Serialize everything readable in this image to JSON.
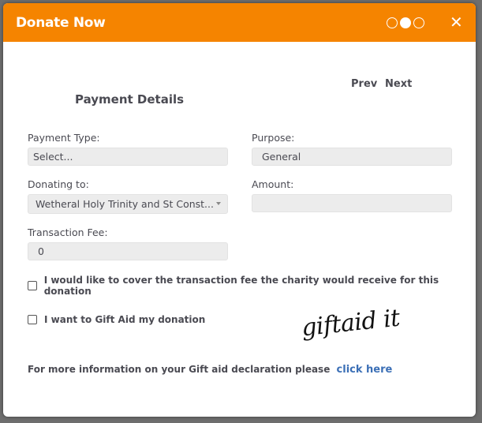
{
  "header": {
    "title": "Donate Now",
    "steps": [
      {
        "state": "inactive"
      },
      {
        "state": "active"
      },
      {
        "state": "inactive"
      }
    ],
    "close_icon": "close-icon",
    "close_glyph": "✕"
  },
  "navigation": {
    "prev_label": "Prev",
    "next_label": "Next"
  },
  "section_title": "Payment Details",
  "form": {
    "payment_type": {
      "label": "Payment Type:",
      "value": "Select..."
    },
    "purpose": {
      "label": "Purpose:",
      "value": "General"
    },
    "donating_to": {
      "label": "Donating to:",
      "value": "Wetheral Holy Trinity and St Const..."
    },
    "amount": {
      "label": "Amount:",
      "value": ""
    },
    "transaction_fee": {
      "label": "Transaction Fee:",
      "value": "0"
    }
  },
  "checkboxes": {
    "cover_fee": {
      "label": "I would like to cover the transaction fee the charity would receive for this donation",
      "checked": false
    },
    "gift_aid": {
      "label": "I want to Gift Aid my donation",
      "checked": false
    }
  },
  "giftaid_logo_text": "giftaid it",
  "info": {
    "text": "For more information on your Gift aid declaration please",
    "link_label": "click here"
  },
  "colors": {
    "header_bg": "#f58400",
    "link": "#3b6fb6",
    "text": "#4a4a52"
  }
}
